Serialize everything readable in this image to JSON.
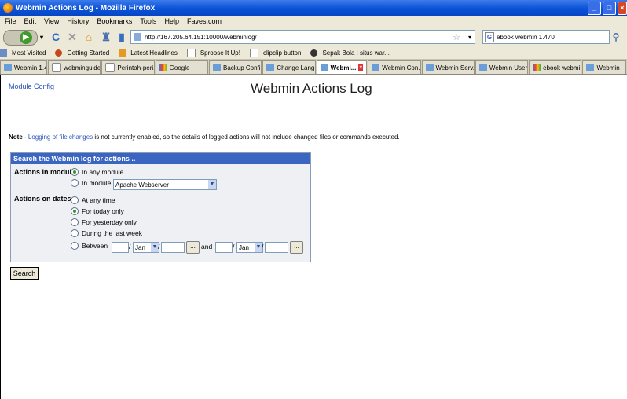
{
  "window": {
    "title": "Webmin Actions Log - Mozilla Firefox"
  },
  "menu": [
    "File",
    "Edit",
    "View",
    "History",
    "Bookmarks",
    "Tools",
    "Help",
    "Faves.com"
  ],
  "nav": {
    "url": "http://167.205.64.151:10000/webminlog/",
    "search_value": "ebook webmin 1.470"
  },
  "bookmarks": [
    "Most Visited",
    "Getting Started",
    "Latest Headlines",
    "Sproose It Up!",
    "clipclip button",
    "Sepak Bola : situs war..."
  ],
  "tabs": [
    {
      "label": "Webmin 1.47..."
    },
    {
      "label": "webminguide..."
    },
    {
      "label": "Perintah-peri..."
    },
    {
      "label": "Google"
    },
    {
      "label": "Backup Confi..."
    },
    {
      "label": "Change Lang..."
    },
    {
      "label": "Webmi..."
    },
    {
      "label": "Webmin Con..."
    },
    {
      "label": "Webmin Serv..."
    },
    {
      "label": "Webmin Users"
    },
    {
      "label": "ebook webmi..."
    },
    {
      "label": "Webmin"
    }
  ],
  "page": {
    "module_config": "Module Config",
    "title": "Webmin Actions Log",
    "note_label": "Note",
    "note_link": "Logging of file changes",
    "note_text": " is not currently enabled, so the details of logged actions will not include changed files or commands executed."
  },
  "form": {
    "header": "Search the Webmin log for actions ..",
    "module_label": "Actions in module",
    "module_opt_any": "In any module",
    "module_opt_in": "In module",
    "module_select": "Apache Webserver",
    "dates_label": "Actions on dates",
    "date_opts": [
      "At any time",
      "For today only",
      "For yesterday only",
      "During the last week",
      "Between"
    ],
    "month_from": "Jan",
    "month_to": "Jan",
    "and_label": "and",
    "dots": "...",
    "slash": "/",
    "search_button": "Search"
  }
}
